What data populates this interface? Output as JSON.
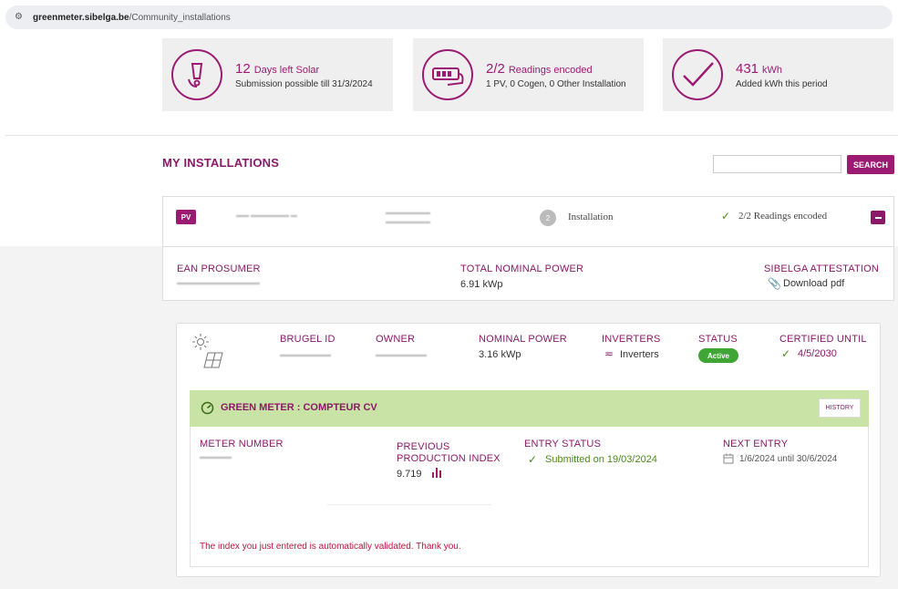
{
  "browser": {
    "domain": "greenmeter.sibelga.be",
    "path": "/Community_installations"
  },
  "stats": [
    {
      "big": "12",
      "unit": "Days left Solar",
      "sub": "Submission possible till 31/3/2024",
      "icon": "warning-pen-icon"
    },
    {
      "big": "2/2",
      "unit": "Readings encoded",
      "sub": "1 PV, 0 Cogen, 0 Other Installation",
      "icon": "meter-icon"
    },
    {
      "big": "431",
      "unit": "kWh",
      "sub": "Added kWh this period",
      "icon": "checkmark-icon"
    }
  ],
  "installations": {
    "title": "MY INSTALLATIONS",
    "search_label": "SEARCH",
    "search_value": "",
    "row": {
      "type_badge": "PV",
      "count": "2",
      "installation_label": "Installation",
      "readings_status": "2/2 Readings encoded"
    },
    "detail": {
      "ean_label": "EAN PROSUMER",
      "power_label": "TOTAL NOMINAL POWER",
      "power_value": "6.91 kWp",
      "attestation_label": "SIBELGA ATTESTATION",
      "download_label": "Download pdf"
    }
  },
  "unit_card": {
    "brugel_label": "BRUGEL ID",
    "owner_label": "OWNER",
    "nominal_label": "NOMINAL POWER",
    "nominal_value": "3.16 kWp",
    "inverters_label": "INVERTERS",
    "inverters_value": "Inverters",
    "status_label": "STATUS",
    "status_value": "Active",
    "certified_label": "CERTIFIED UNTIL",
    "certified_value": "4/5/2030"
  },
  "green_meter": {
    "title": "GREEN METER : COMPTEUR CV",
    "history_label": "HISTORY",
    "meter_number_label": "METER NUMBER",
    "prev_index_label_1": "PREVIOUS",
    "prev_index_label_2": "PRODUCTION INDEX",
    "prev_index_value": "9.719",
    "entry_status_label": "ENTRY STATUS",
    "entry_status_value": "Submitted on 19/03/2024",
    "next_entry_label": "NEXT ENTRY",
    "next_entry_value": "1/6/2024 until 30/6/2024",
    "message": "The index you just entered is automatically validated. Thank you."
  },
  "colors": {
    "accent": "#9b1b73",
    "green_header": "#c9e2a5",
    "active": "#3fa635",
    "error_text": "#c0133c"
  }
}
